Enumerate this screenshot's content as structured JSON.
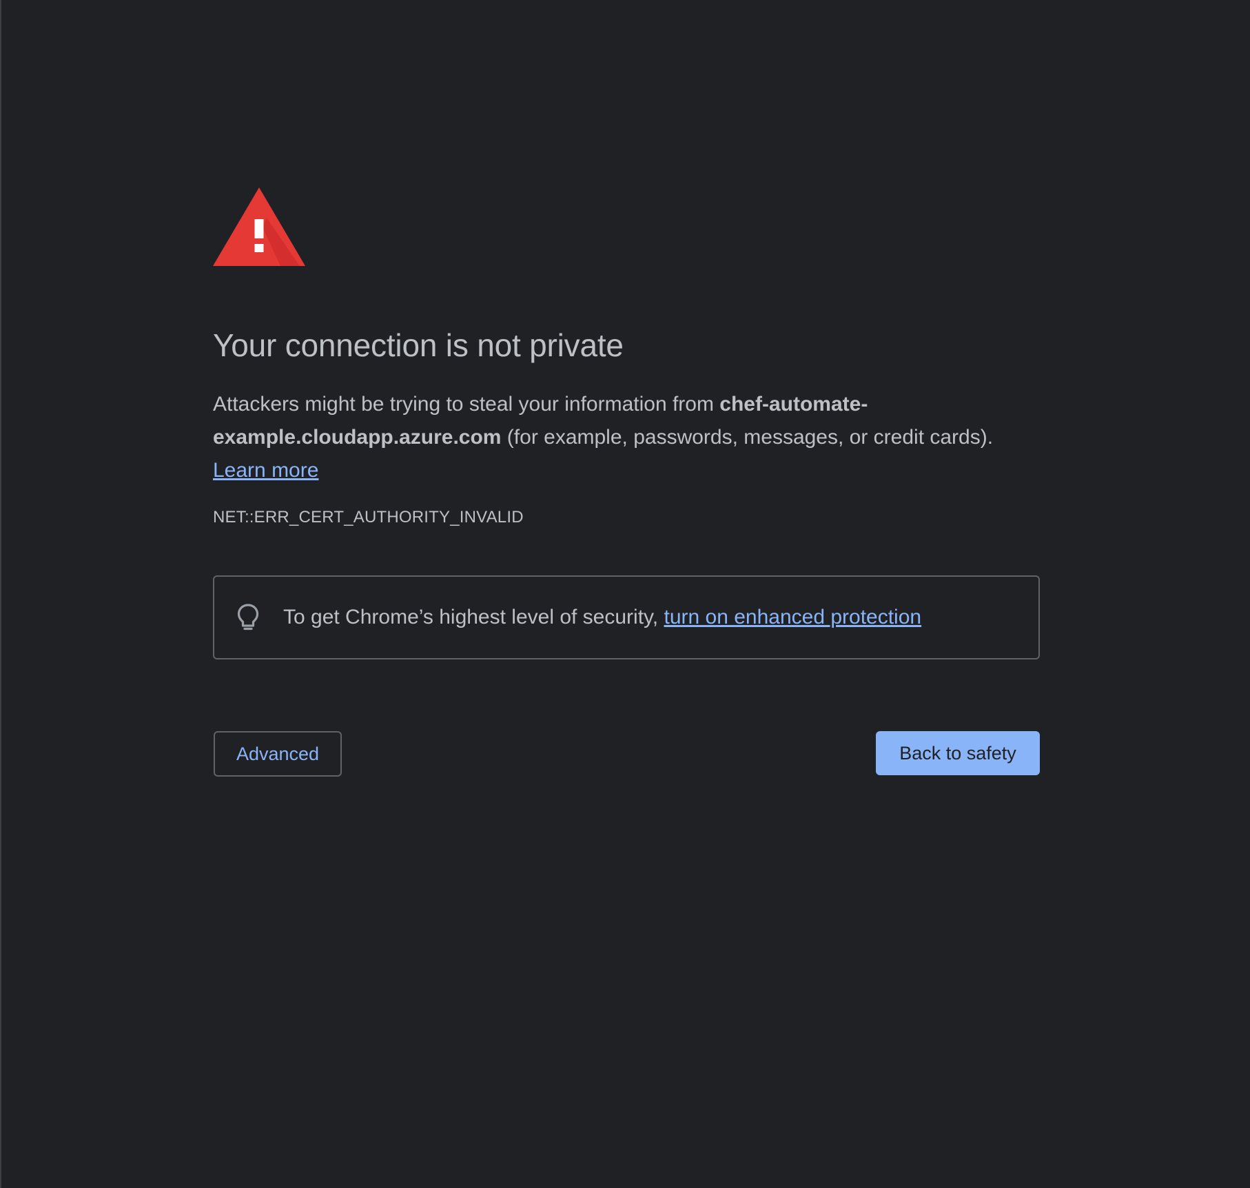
{
  "page": {
    "title": "Your connection is not private",
    "explanation_prefix": "Attackers might be trying to steal your information from ",
    "host": "chef-automate-example.cloudapp.azure.com",
    "explanation_suffix": " (for example, passwords, messages, or credit cards). ",
    "learn_more": "Learn more",
    "error_code": "NET::ERR_CERT_AUTHORITY_INVALID"
  },
  "enhanced_protection": {
    "icon": "lightbulb-icon",
    "text": "To get Chrome’s highest level of security, ",
    "link": "turn on enhanced protection"
  },
  "buttons": {
    "advanced": "Advanced",
    "back_to_safety": "Back to safety"
  },
  "icons": {
    "warning": "warning-triangle-icon"
  },
  "colors": {
    "background": "#202124",
    "text": "#bdc1c6",
    "link": "#8ab4f8",
    "primary_button": "#8ab4f8",
    "warning_red": "#e53935",
    "border": "#5f6368"
  }
}
